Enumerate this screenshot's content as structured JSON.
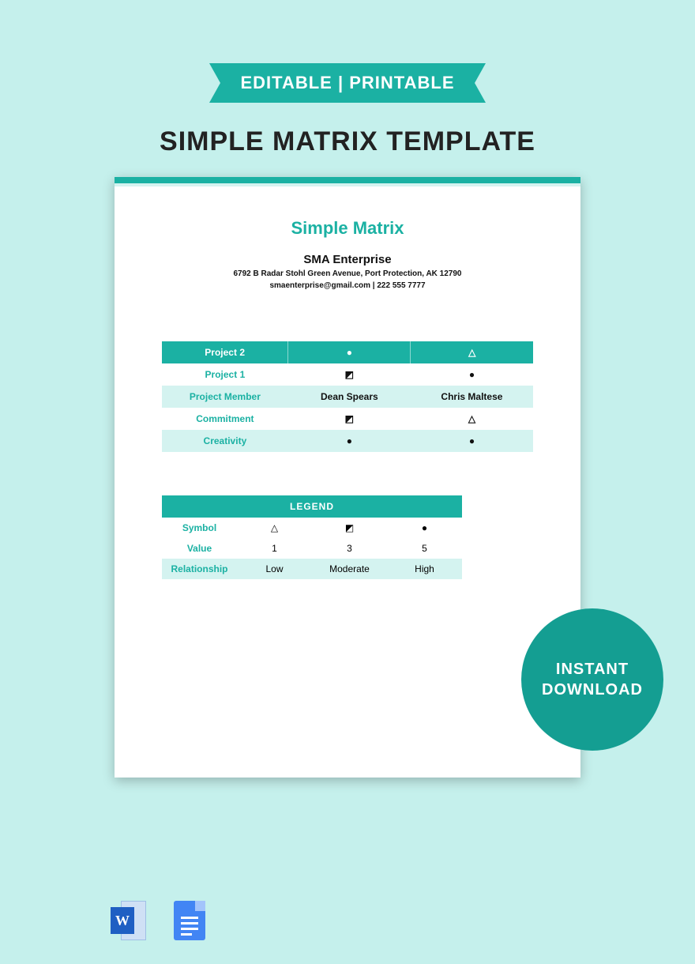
{
  "ribbon": "EDITABLE | PRINTABLE",
  "page_title": "SIMPLE MATRIX TEMPLATE",
  "doc": {
    "title": "Simple Matrix",
    "company": "SMA Enterprise",
    "address": "6792 B Radar Stohl Green Avenue, Port Protection, AK 12790",
    "contact": "smaenterprise@gmail.com | 222 555 7777"
  },
  "matrix": {
    "header": {
      "label": "Project 2",
      "c1": "●",
      "c2": "△"
    },
    "rows": [
      {
        "label": "Project 1",
        "c1": "◩",
        "c2": "●",
        "alt": false
      },
      {
        "label": "Project Member",
        "c1": "Dean Spears",
        "c2": "Chris Maltese",
        "alt": true
      },
      {
        "label": "Commitment",
        "c1": "◩",
        "c2": "△",
        "alt": false
      },
      {
        "label": "Creativity",
        "c1": "●",
        "c2": "●",
        "alt": true
      }
    ]
  },
  "legend": {
    "title": "LEGEND",
    "rows": [
      {
        "label": "Symbol",
        "v1": "△",
        "v2": "◩",
        "v3": "●",
        "alt": false
      },
      {
        "label": "Value",
        "v1": "1",
        "v2": "3",
        "v3": "5",
        "alt": false
      },
      {
        "label": "Relationship",
        "v1": "Low",
        "v2": "Moderate",
        "v3": "High",
        "alt": true
      }
    ]
  },
  "badge": {
    "l1": "INSTANT",
    "l2": "DOWNLOAD"
  },
  "word_glyph": "W"
}
